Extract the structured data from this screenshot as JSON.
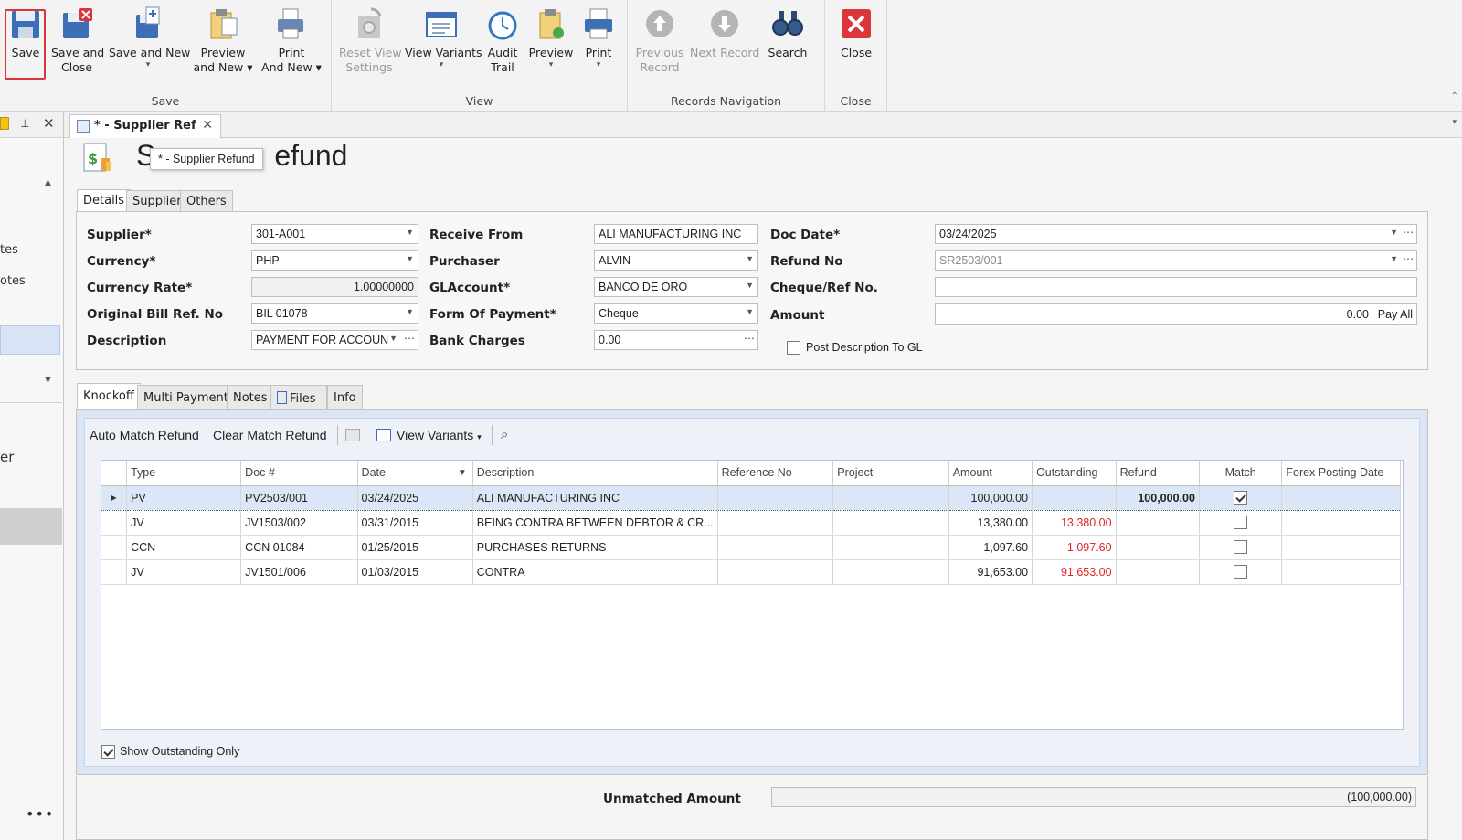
{
  "ribbon": {
    "groups": {
      "save": "Save",
      "view": "View",
      "records_navigation": "Records Navigation",
      "close": "Close"
    },
    "buttons": {
      "save": "Save",
      "save_and_close_1": "Save and",
      "save_and_close_2": "Close",
      "save_and_new": "Save and New",
      "preview_and_new_1": "Preview",
      "preview_and_new_2": "and New",
      "print_and_new_1": "Print",
      "print_and_new_2": "And New",
      "reset_view_1": "Reset View",
      "reset_view_2": "Settings",
      "view_variants": "View Variants",
      "audit_trail_1": "Audit",
      "audit_trail_2": "Trail",
      "preview": "Preview",
      "print": "Print",
      "previous_record_1": "Previous",
      "previous_record_2": "Record",
      "next_record": "Next Record",
      "search": "Search",
      "close": "Close"
    }
  },
  "doc_tab": {
    "label": "* - Supplier Ref"
  },
  "page_title": {
    "left": "S",
    "right": "efund"
  },
  "tooltip": "* - Supplier Refund",
  "top_tabs": [
    "Details",
    "Supplier",
    "Others"
  ],
  "form": {
    "supplier_label": "Supplier*",
    "supplier_value": "301-A001",
    "currency_label": "Currency*",
    "currency_value": "PHP",
    "currency_rate_label": "Currency Rate*",
    "currency_rate_value": "1.00000000",
    "original_bill_label": "Original Bill Ref. No",
    "original_bill_value": "BIL 01078",
    "description_label": "Description",
    "description_value": "PAYMENT FOR ACCOUN",
    "receive_from_label": "Receive From",
    "receive_from_value": "ALI MANUFACTURING INC",
    "purchaser_label": "Purchaser",
    "purchaser_value": "ALVIN",
    "glaccount_label": "GLAccount*",
    "glaccount_value": "BANCO DE ORO",
    "form_of_payment_label": "Form Of Payment*",
    "form_of_payment_value": "Cheque",
    "bank_charges_label": "Bank Charges",
    "bank_charges_value": "0.00",
    "doc_date_label": "Doc Date*",
    "doc_date_value": "03/24/2025",
    "refund_no_label": "Refund No",
    "refund_no_value": "SR2503/001",
    "cheque_ref_label": "Cheque/Ref No.",
    "cheque_ref_value": "",
    "amount_label": "Amount",
    "amount_value": "0.00",
    "pay_all": "Pay All",
    "post_desc_label": "Post Description To GL"
  },
  "bottom_tabs": [
    "Knockoff",
    "Multi Payments",
    "Notes",
    "Files",
    "Info"
  ],
  "knockoff_toolbar": {
    "auto_match": "Auto Match Refund",
    "clear_match": "Clear Match Refund",
    "view_variants": "View Variants"
  },
  "grid": {
    "columns": [
      "Type",
      "Doc #",
      "Date",
      "Description",
      "Reference No",
      "Project",
      "Amount",
      "Outstanding",
      "Refund",
      "Match",
      "Forex Posting Date"
    ],
    "rows": [
      {
        "type": "PV",
        "doc": "PV2503/001",
        "date": "03/24/2025",
        "description": "ALI MANUFACTURING INC",
        "reference": "",
        "project": "",
        "amount": "100,000.00",
        "outstanding": "",
        "refund": "100,000.00",
        "match": true,
        "forex": ""
      },
      {
        "type": "JV",
        "doc": "JV1503/002",
        "date": "03/31/2015",
        "description": "BEING CONTRA BETWEEN DEBTOR & CR...",
        "reference": "",
        "project": "",
        "amount": "13,380.00",
        "outstanding": "13,380.00",
        "refund": "",
        "match": false,
        "forex": ""
      },
      {
        "type": "CCN",
        "doc": "CCN 01084",
        "date": "01/25/2015",
        "description": "PURCHASES RETURNS",
        "reference": "",
        "project": "",
        "amount": "1,097.60",
        "outstanding": "1,097.60",
        "refund": "",
        "match": false,
        "forex": ""
      },
      {
        "type": "JV",
        "doc": "JV1501/006",
        "date": "01/03/2015",
        "description": "CONTRA",
        "reference": "",
        "project": "",
        "amount": "91,653.00",
        "outstanding": "91,653.00",
        "refund": "",
        "match": false,
        "forex": ""
      }
    ]
  },
  "show_outstanding_only": "Show Outstanding Only",
  "unmatched": {
    "label": "Unmatched Amount",
    "value": "(100,000.00)"
  },
  "left_pane": {
    "item1": "tes",
    "item2": "otes",
    "item3": "er"
  },
  "colors": {
    "accent_red": "#d9353b",
    "selection": "#dbe6f7",
    "outstanding_red": "#e0242b"
  }
}
